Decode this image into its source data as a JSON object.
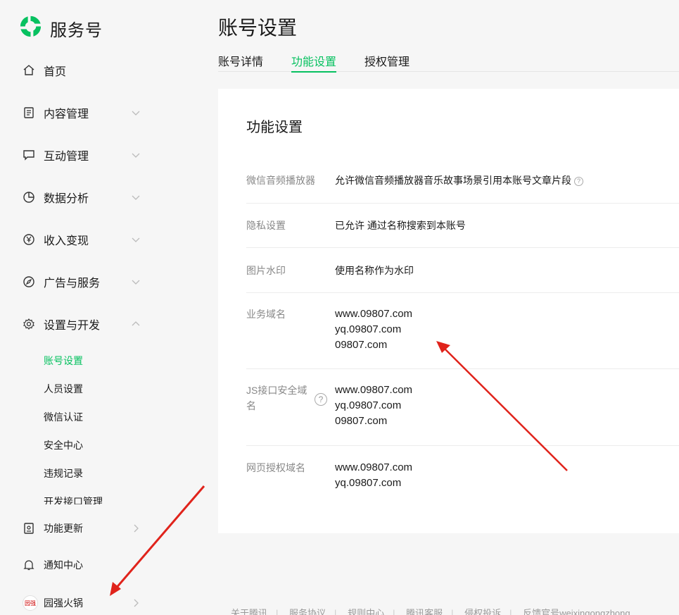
{
  "brand": {
    "name": "服务号",
    "accent": "#07c160"
  },
  "sidebar": {
    "items": [
      {
        "label": "首页",
        "icon": "home-icon"
      },
      {
        "label": "内容管理",
        "icon": "document-icon"
      },
      {
        "label": "互动管理",
        "icon": "chat-icon"
      },
      {
        "label": "数据分析",
        "icon": "pie-chart-icon"
      },
      {
        "label": "收入变现",
        "icon": "yen-icon"
      },
      {
        "label": "广告与服务",
        "icon": "compass-icon"
      },
      {
        "label": "设置与开发",
        "icon": "gear-icon"
      }
    ],
    "subitems": [
      "账号设置",
      "人员设置",
      "微信认证",
      "安全中心",
      "违规记录",
      "开发接口管理"
    ],
    "bottom_items": [
      {
        "label": "功能更新",
        "icon": "update-icon"
      },
      {
        "label": "通知中心",
        "icon": "bell-icon"
      },
      {
        "label": "园强火锅",
        "icon": "avatar"
      }
    ],
    "avatar_text": "园强"
  },
  "header": {
    "title": "账号设置"
  },
  "tabs": [
    "账号详情",
    "功能设置",
    "授权管理"
  ],
  "card": {
    "title": "功能设置",
    "rows": [
      {
        "label": "微信音频播放器",
        "value": "允许微信音频播放器音乐故事场景引用本账号文章片段"
      },
      {
        "label": "隐私设置",
        "value": "已允许 通过名称搜索到本账号"
      },
      {
        "label": "图片水印",
        "value": "使用名称作为水印"
      },
      {
        "label": "业务域名",
        "values": [
          "www.09807.com",
          "yq.09807.com",
          "09807.com"
        ]
      },
      {
        "label": "JS接口安全域名",
        "label_lines": [
          "JS接口安全域",
          "名"
        ],
        "values": [
          "www.09807.com",
          "yq.09807.com",
          "09807.com"
        ]
      },
      {
        "label": "网页授权域名",
        "values": [
          "www.09807.com",
          "yq.09807.com"
        ]
      }
    ]
  },
  "footer": {
    "links": [
      "关于腾讯",
      "服务协议",
      "规则中心",
      "腾讯客服",
      "侵权投诉",
      "反馈官号weixingongzhong"
    ]
  },
  "colors": {
    "accent": "#07c160",
    "annotation_arrow": "#e0231b"
  }
}
